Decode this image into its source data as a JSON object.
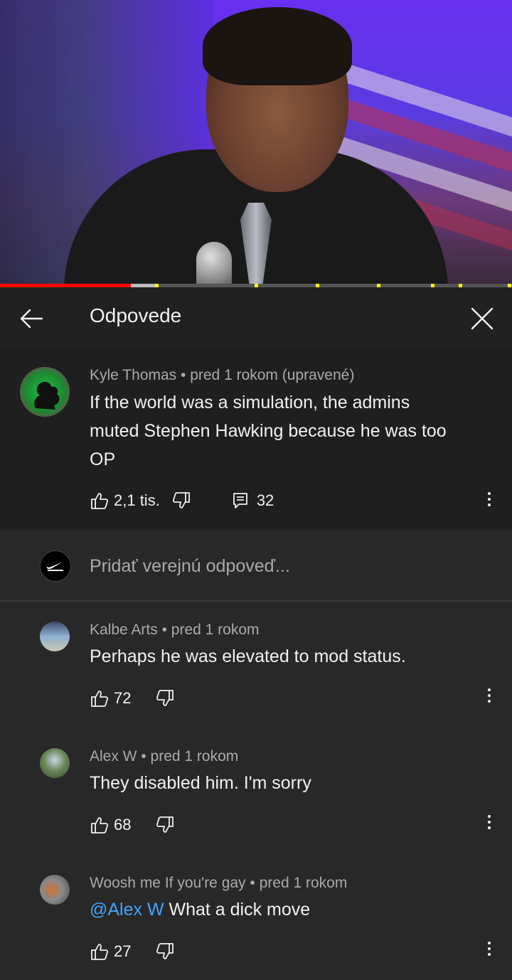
{
  "header": {
    "title": "Odpovede"
  },
  "main_comment": {
    "author": "Kyle Thomas",
    "time": "pred 1 rokom (upravené)",
    "text_lines": [
      "If the world was a simulation, the admins",
      "muted Stephen Hawking because he was too",
      "OP"
    ],
    "likes": "2,1 tis.",
    "replies_count": "32"
  },
  "add_reply": {
    "placeholder": "Pridať verejnú odpoveď..."
  },
  "replies": [
    {
      "author": "Kalbe Arts",
      "time": "pred 1 rokom",
      "mention": "",
      "text": "Perhaps he was elevated to mod status.",
      "likes": "72"
    },
    {
      "author": "Alex W",
      "time": "pred 1 rokom",
      "mention": "",
      "text": "They disabled him. I'm sorry",
      "likes": "68"
    },
    {
      "author": "Woosh me If you're gay",
      "time": "pred 1 rokom",
      "mention": "@Alex W",
      "text": " What a dick move",
      "likes": "27"
    }
  ],
  "meta_separator": " • ",
  "colors": {
    "accent": "#ff0000",
    "mention": "#3ea6ff",
    "background": "#282828"
  },
  "player": {
    "progress_played": 0.255,
    "progress_buffered": 0.31
  }
}
